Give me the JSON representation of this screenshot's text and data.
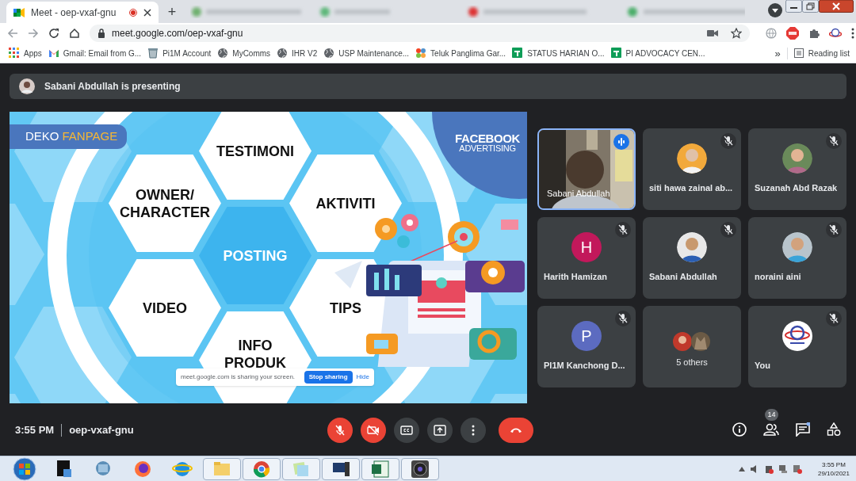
{
  "browser": {
    "tab": {
      "title": "Meet - oep-vxaf-gnu",
      "recording": true
    },
    "new_tab": "+",
    "address": "meet.google.com/oep-vxaf-gnu",
    "bookmarks": [
      {
        "label": "Apps",
        "kind": "apps"
      },
      {
        "label": "Gmail: Email from G...",
        "kind": "gmail"
      },
      {
        "label": "Pi1M Account",
        "kind": "bin"
      },
      {
        "label": "MyComms",
        "kind": "globe"
      },
      {
        "label": "IHR V2",
        "kind": "globe"
      },
      {
        "label": "USP Maintenance...",
        "kind": "globe"
      },
      {
        "label": "Teluk Panglima Gar...",
        "kind": "joomla"
      },
      {
        "label": "STATUS HARIAN O...",
        "kind": "sheet"
      },
      {
        "label": "PI ADVOCACY CEN...",
        "kind": "sheet"
      }
    ],
    "overflow": "»",
    "reading_list": "Reading list"
  },
  "meet": {
    "presenting": "Sabani Abdullah is presenting",
    "slide": {
      "badge_prefix": "DEKO",
      "badge_highlight": "FANPAGE",
      "corner_title": "FACEBOOK",
      "corner_subtitle": "ADVERTISING",
      "hexagons": [
        {
          "label": "TESTIMONI",
          "kind": "top"
        },
        {
          "label": "OWNER/ CHARACTER",
          "kind": "upper_left"
        },
        {
          "label": "AKTIVITI",
          "kind": "upper_right"
        },
        {
          "label": "POSTING",
          "kind": "center"
        },
        {
          "label": "VIDEO",
          "kind": "lower_left"
        },
        {
          "label": "TIPS",
          "kind": "lower_right"
        },
        {
          "label": "INFO PRODUK",
          "kind": "bottom"
        }
      ],
      "share_bar": {
        "text": "meet.google.com is sharing your screen.",
        "button": "Stop sharing",
        "link": "Hide"
      }
    },
    "participants": [
      {
        "name": "Sabani Abdullah",
        "kind": "video",
        "speaking": true,
        "muted": false
      },
      {
        "name": "siti hawa zainal ab...",
        "speaking": false,
        "muted": true
      },
      {
        "name": "Suzanah Abd Razak",
        "speaking": false,
        "muted": true
      },
      {
        "name": "Harith Hamizan",
        "kind": "initial",
        "initial": "H",
        "color": "#c2185b",
        "speaking": false,
        "muted": true
      },
      {
        "name": "Sabani Abdullah",
        "speaking": false,
        "muted": true
      },
      {
        "name": "noraini aini",
        "speaking": false,
        "muted": true
      },
      {
        "name": "PI1M Kanchong D...",
        "kind": "initial",
        "initial": "P",
        "color": "#5c6bc0",
        "speaking": false,
        "muted": true
      },
      {
        "name": "5 others",
        "kind": "group",
        "speaking": false,
        "muted": false
      },
      {
        "name": "You",
        "kind": "logo",
        "speaking": false,
        "muted": true
      }
    ],
    "time": "3:55 PM",
    "meeting_code": "oep-vxaf-gnu",
    "participant_count": "14",
    "chat_unread": true
  },
  "taskbar": {
    "time": "3:55 PM",
    "date": "29/10/2021"
  }
}
